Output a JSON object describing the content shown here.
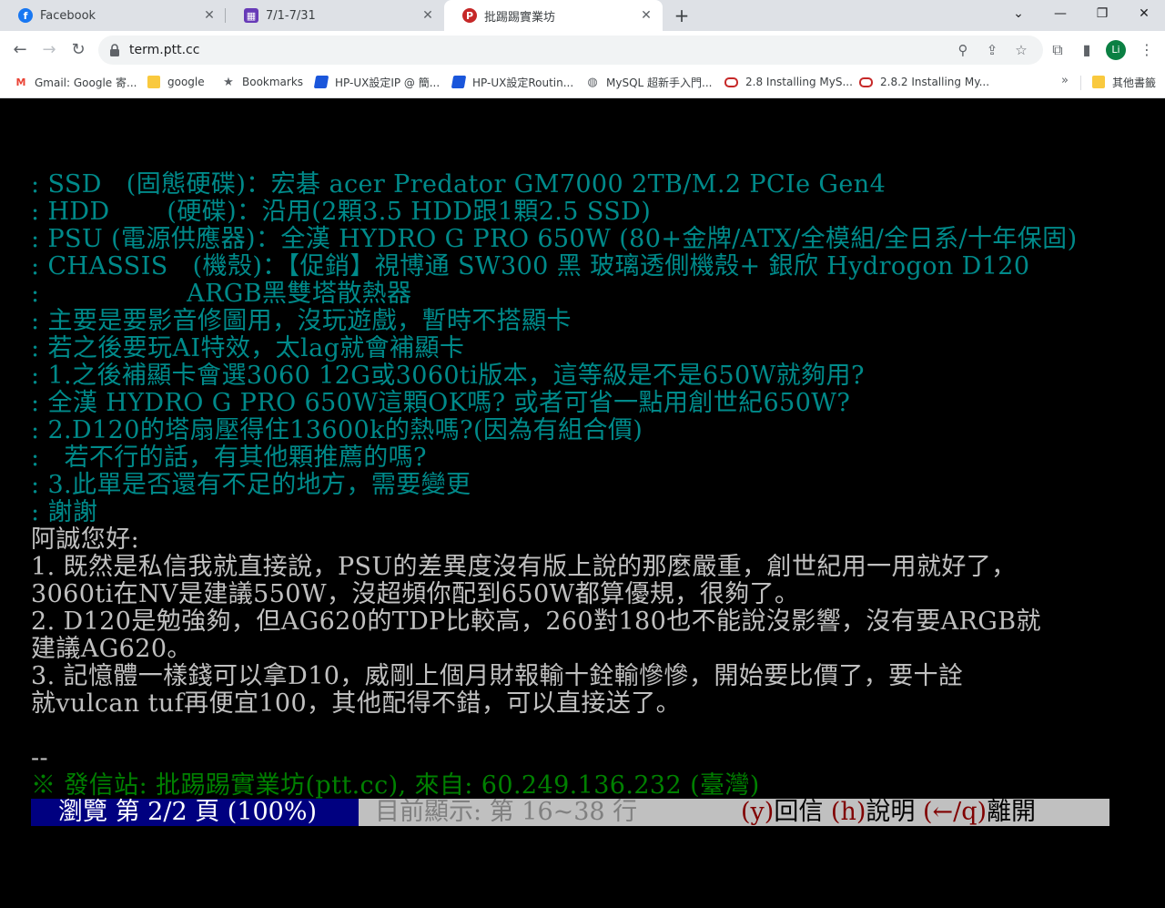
{
  "browser": {
    "tabs": [
      {
        "label": "Facebook",
        "icon": "facebook-icon",
        "color": "#1877f2"
      },
      {
        "label": "7/1-7/31",
        "icon": "calendar-icon",
        "color": "#673ab7"
      },
      {
        "label": "批踢踢實業坊",
        "icon": "ptt-icon",
        "color": "#c62828",
        "active": true
      }
    ],
    "url": "term.ptt.cc",
    "profile_initials": "Li",
    "bookmarks": [
      {
        "label": "Gmail: Google 寄...",
        "icon": "gmail-icon"
      },
      {
        "label": "google",
        "icon": "folder-icon"
      },
      {
        "label": "Bookmarks",
        "icon": "star-icon"
      },
      {
        "label": "HP-UX設定IP @ 簡...",
        "icon": "bookmark-page-icon"
      },
      {
        "label": "HP-UX設定Routin...",
        "icon": "bookmark-page-icon"
      },
      {
        "label": "MySQL 超新手入門...",
        "icon": "globe-icon"
      },
      {
        "label": "2.8 Installing MyS...",
        "icon": "oracle-icon"
      },
      {
        "label": "2.8.2 Installing My...",
        "icon": "oracle-icon"
      }
    ],
    "other_bookmarks": "其他書籤"
  },
  "terminal": {
    "quoted_lines": [
      ": SSD   (固態硬碟)：宏碁 acer Predator GM7000 2TB/M.2 PCIe Gen4",
      ": HDD       (硬碟)：沿用(2顆3.5 HDD跟1顆2.5 SSD)",
      ": PSU (電源供應器)：全漢 HYDRO G PRO 650W (80+金牌/ATX/全模組/全日系/十年保固)",
      ": CHASSIS   (機殼)：【促銷】視博通 SW300 黑 玻璃透側機殼+ 銀欣 Hydrogon D120",
      ":                  ARGB黑雙塔散熱器",
      ": 主要是要影音修圖用，沒玩遊戲，暫時不搭顯卡",
      ": 若之後要玩AI特效，太lag就會補顯卡",
      ": 1.之後補顯卡會選3060 12G或3060ti版本，這等級是不是650W就夠用?",
      ": 全漢 HYDRO G PRO 650W這顆OK嗎? 或者可省一點用創世紀650W?",
      ": 2.D120的塔扇壓得住13600k的熱嗎?(因為有組合價)",
      ":   若不行的話，有其他顆推薦的嗎?",
      ": 3.此單是否還有不足的地方，需要變更",
      ": 謝謝"
    ],
    "reply_lines": [
      "阿誠您好:",
      "1. 既然是私信我就直接說，PSU的差異度沒有版上說的那麼嚴重，創世紀用一用就好了，",
      "3060ti在NV是建議550W，沒超頻你配到650W都算優規，很夠了。",
      "2. D120是勉強夠，但AG620的TDP比較高，260對180也不能說沒影響，沒有要ARGB就",
      "建議AG620。",
      "3. 記憶體一樣錢可以拿D10，威剛上個月財報輸十銓輸慘慘，開始要比價了，要十詮",
      "就vulcan tuf再便宜100，其他配得不錯，可以直接送了。"
    ],
    "signature_sep": "--",
    "signature": "※ 發信站: 批踢踢實業坊(ptt.cc), 來自: 60.249.136.232 (臺灣)",
    "status": {
      "page": "瀏覽 第 2/2 頁 (100%)",
      "showing": "目前顯示: 第 16~38 行",
      "reply_key": "(y)",
      "reply_label": "回信",
      "help_key": "(h)",
      "help_label": "說明",
      "quit_key": "(←/q)",
      "quit_label": "離開"
    }
  }
}
